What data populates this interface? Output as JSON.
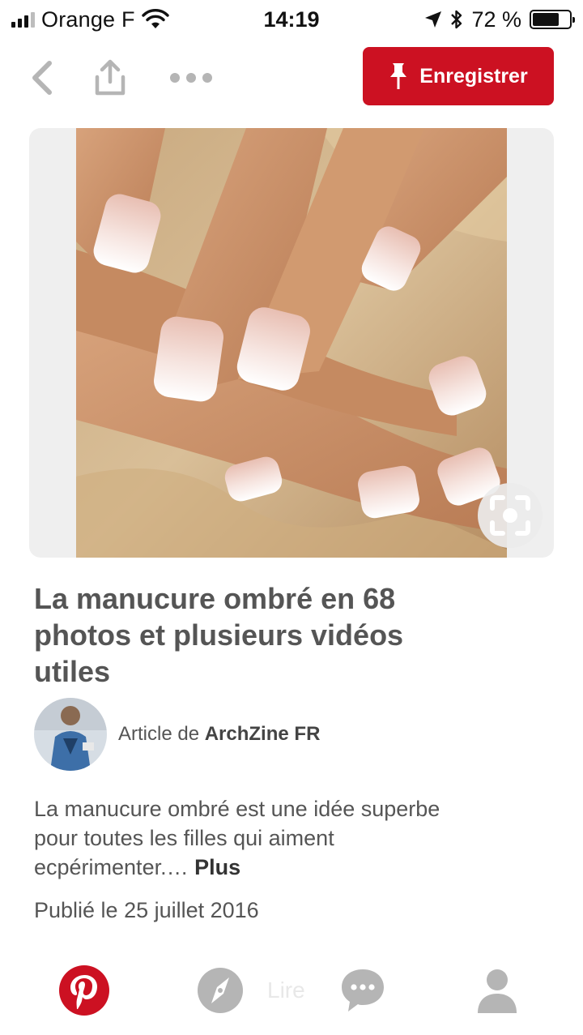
{
  "status_bar": {
    "carrier": "Orange F",
    "time": "14:19",
    "battery": "72 %",
    "battery_level": 0.72
  },
  "nav": {
    "back_icon": "chevron-left-icon",
    "share_icon": "share-icon",
    "more_icon": "more-dots-icon",
    "save_label": "Enregistrer",
    "save_icon": "pin-icon"
  },
  "pin": {
    "title": "La manucure ombré en 68 photos et plusieurs vidéos utiles",
    "author_prefix": "Article de",
    "author_name": "ArchZine FR",
    "description": "La manucure ombré est une idée superbe pour toutes les filles qui aiment ecpérimenter.…",
    "more_label": "Plus",
    "published": "Publié le 25 juillet 2016"
  },
  "tabbar": {
    "hidden_label": "Lire",
    "tabs": [
      {
        "icon": "pinterest-logo-icon",
        "active": true
      },
      {
        "icon": "compass-icon",
        "active": false
      },
      {
        "icon": "chat-bubble-icon",
        "active": false
      },
      {
        "icon": "profile-icon",
        "active": false
      }
    ]
  },
  "colors": {
    "brand_red": "#cc1122",
    "icon_gray": "#b5b5b5",
    "text_gray": "#555555"
  }
}
